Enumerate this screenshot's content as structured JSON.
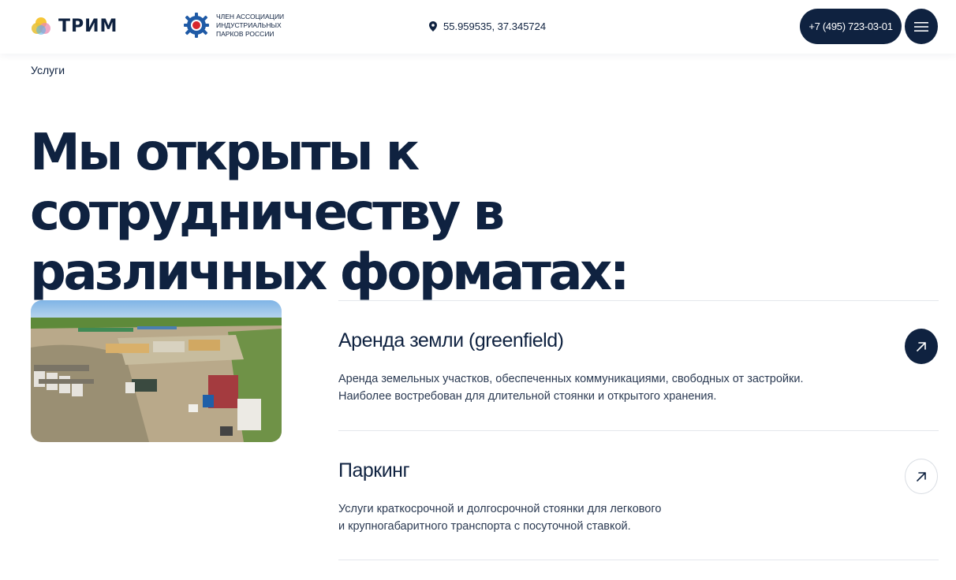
{
  "header": {
    "logo_text": "ТРИМ",
    "association_text": "ЧЛЕН АССОЦИАЦИИ ИНДУСТРИАЛЬНЫХ ПАРКОВ РОССИИ",
    "coordinates": "55.959535, 37.345724",
    "phone": "+7 (495) 723-03-01",
    "icons": {
      "location": "map-pin-icon",
      "menu": "hamburger-menu-icon"
    }
  },
  "breadcrumb": "Услуги",
  "page_title": "Мы открыты к сотрудничеству в различных форматах:",
  "services": [
    {
      "title": "Аренда земли (greenfield)",
      "desc_lines": [
        "Аренда земельных участков, обеспеченных коммуникациями, свободных от застройки.",
        "Наиболее востребован для длительной стоянки и открытого хранения."
      ],
      "arrow_style": "filled"
    },
    {
      "title": "Паркинг",
      "desc_lines": [
        "Услуги краткосрочной и долгосрочной стоянки для легкового",
        "и крупногабаритного транспорта с посуточной ставкой."
      ],
      "arrow_style": "outline"
    }
  ],
  "colors": {
    "primary": "#0f2240",
    "divider": "#e4e7ec",
    "logo_yellow": "#f5c32c",
    "logo_pink": "#e98ab0",
    "logo_blue": "#5ab4e5",
    "assoc_red": "#d7262d",
    "assoc_blue": "#1f5aa6"
  }
}
